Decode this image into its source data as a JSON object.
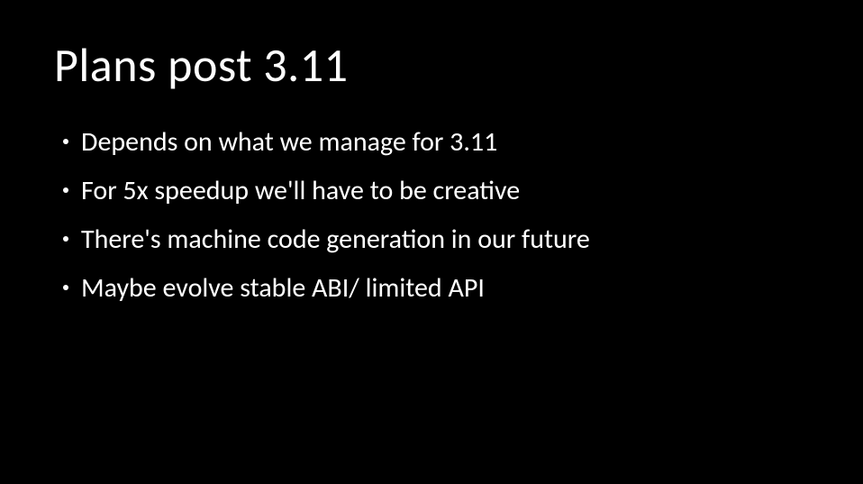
{
  "slide": {
    "title": "Plans post 3.11",
    "bullets": [
      "Depends on what we manage for 3.11",
      "For 5x speedup we'll have to be creative",
      "There's machine code generation in our future",
      "Maybe evolve stable ABI/ limited API"
    ]
  }
}
